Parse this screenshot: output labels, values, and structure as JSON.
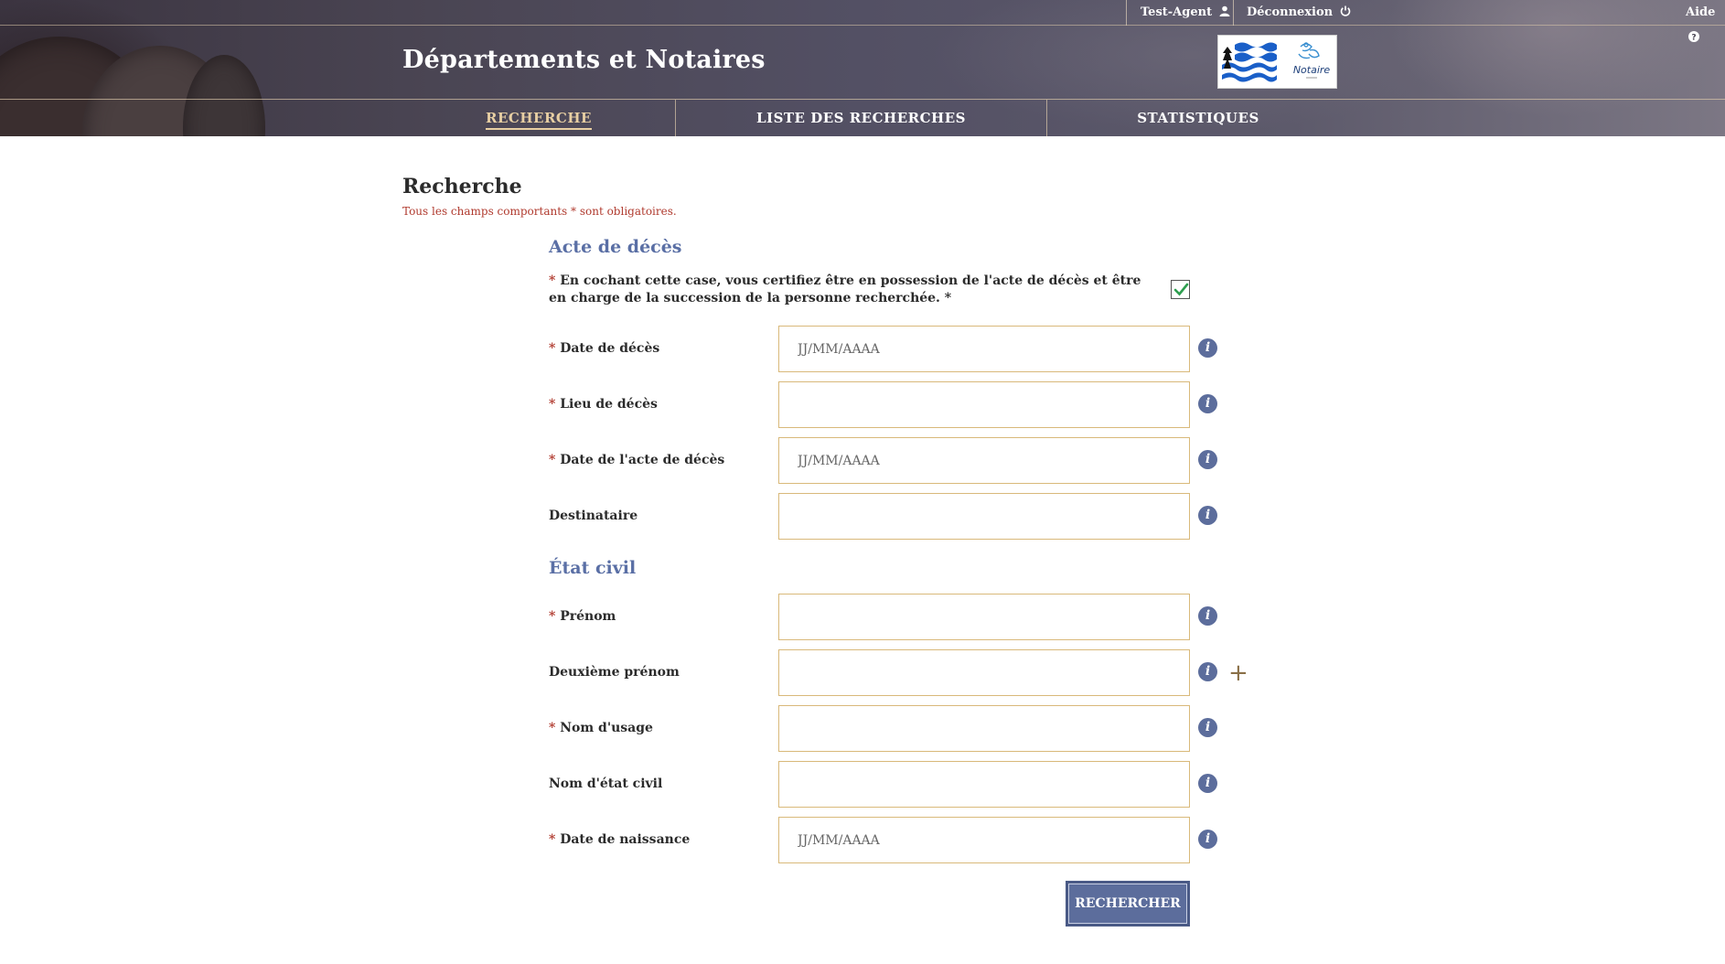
{
  "header": {
    "user_label": "Test-Agent",
    "logout_label": "Déconnexion",
    "help_label": "Aide",
    "site_title": "Départements et Notaires",
    "logo_text": "Notaire"
  },
  "nav": {
    "tabs": [
      {
        "label": "RECHERCHE",
        "active": true
      },
      {
        "label": "LISTE DES RECHERCHES",
        "active": false
      },
      {
        "label": "STATISTIQUES",
        "active": false
      }
    ]
  },
  "page": {
    "title": "Recherche",
    "required_note": "Tous les champs comportants * sont obligatoires."
  },
  "sections": {
    "acte": {
      "title": "Acte de décès",
      "certification_text": "En cochant cette case, vous certifiez être en possession de l'acte de décès et être en charge de la succession de la personne recherchée. *",
      "certification_checked": true,
      "fields": [
        {
          "label": "Date de décès",
          "required": true,
          "placeholder": "JJ/MM/AAAA",
          "value": ""
        },
        {
          "label": "Lieu de décès",
          "required": true,
          "placeholder": "",
          "value": ""
        },
        {
          "label": "Date de l'acte de décès",
          "required": true,
          "placeholder": "JJ/MM/AAAA",
          "value": ""
        },
        {
          "label": "Destinataire",
          "required": false,
          "placeholder": "",
          "value": ""
        }
      ]
    },
    "etat_civil": {
      "title": "État civil",
      "fields": [
        {
          "label": "Prénom",
          "required": true,
          "placeholder": "",
          "value": ""
        },
        {
          "label": "Deuxième prénom",
          "required": false,
          "placeholder": "",
          "value": ""
        },
        {
          "label": "Nom d'usage",
          "required": true,
          "placeholder": "",
          "value": ""
        },
        {
          "label": "Nom d'état civil",
          "required": false,
          "placeholder": "",
          "value": ""
        },
        {
          "label": "Date de naissance",
          "required": true,
          "placeholder": "JJ/MM/AAAA",
          "value": ""
        }
      ]
    }
  },
  "actions": {
    "search_label": "RECHERCHER"
  },
  "icons": {
    "info": "info-icon",
    "add": "plus-icon",
    "user": "user-icon",
    "logout": "power-icon",
    "help": "question-icon",
    "check": "check-icon"
  },
  "colors": {
    "accent": "#5c6d9c",
    "field_border": "#d9b97a",
    "required": "#b03a2e",
    "check": "#2e9e4f",
    "active_tab": "#e8cfa3"
  }
}
